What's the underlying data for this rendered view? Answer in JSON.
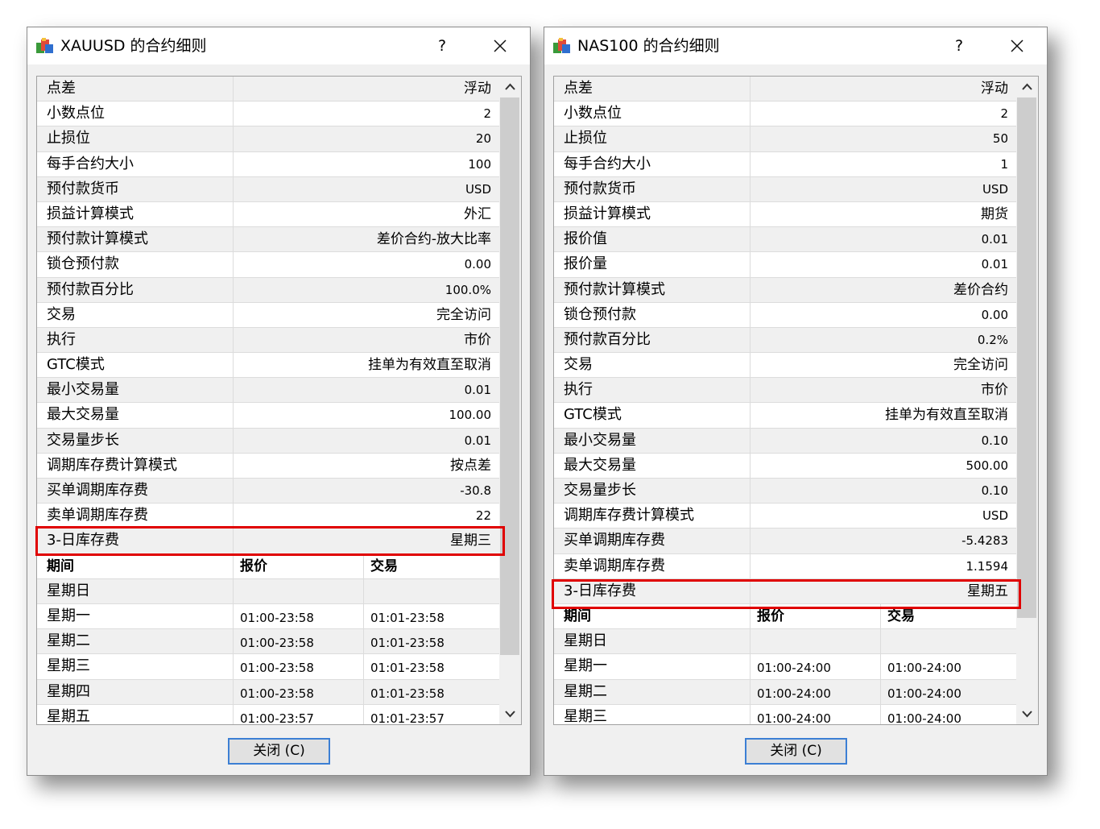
{
  "colors": {
    "highlight": "#e00000",
    "button_border": "#3c7fd4"
  },
  "dialogs": [
    {
      "title": "XAUUSD 的合约细则",
      "help": "?",
      "close_label": "关闭 (C)",
      "rows": [
        {
          "label": "点差",
          "value": "浮动"
        },
        {
          "label": "小数点位",
          "value": "2"
        },
        {
          "label": "止损位",
          "value": "20"
        },
        {
          "label": "每手合约大小",
          "value": "100"
        },
        {
          "label": "预付款货币",
          "value": "USD"
        },
        {
          "label": "损益计算模式",
          "value": "外汇"
        },
        {
          "label": "预付款计算模式",
          "value": "差价合约-放大比率"
        },
        {
          "label": "锁仓预付款",
          "value": "0.00"
        },
        {
          "label": "预付款百分比",
          "value": "100.0%"
        },
        {
          "label": "交易",
          "value": "完全访问"
        },
        {
          "label": "执行",
          "value": "市价"
        },
        {
          "label": "GTC模式",
          "value": "挂单为有效直至取消"
        },
        {
          "label": "最小交易量",
          "value": "0.01"
        },
        {
          "label": "最大交易量",
          "value": "100.00"
        },
        {
          "label": "交易量步长",
          "value": "0.01"
        },
        {
          "label": "调期库存费计算模式",
          "value": "按点差"
        },
        {
          "label": "买单调期库存费",
          "value": "-30.8"
        },
        {
          "label": "卖单调期库存费",
          "value": "22"
        },
        {
          "label": "3-日库存费",
          "value": "星期三"
        }
      ],
      "schedule_header": {
        "day": "期间",
        "quote": "报价",
        "trade": "交易"
      },
      "schedule": [
        {
          "day": "星期日",
          "quote": "",
          "trade": ""
        },
        {
          "day": "星期一",
          "quote": "01:00-23:58",
          "trade": "01:01-23:58"
        },
        {
          "day": "星期二",
          "quote": "01:00-23:58",
          "trade": "01:01-23:58"
        },
        {
          "day": "星期三",
          "quote": "01:00-23:58",
          "trade": "01:01-23:58"
        },
        {
          "day": "星期四",
          "quote": "01:00-23:58",
          "trade": "01:01-23:58"
        },
        {
          "day": "星期五",
          "quote": "01:00-23:57",
          "trade": "01:01-23:57"
        }
      ]
    },
    {
      "title": "NAS100 的合约细则",
      "help": "?",
      "close_label": "关闭 (C)",
      "rows": [
        {
          "label": "点差",
          "value": "浮动"
        },
        {
          "label": "小数点位",
          "value": "2"
        },
        {
          "label": "止损位",
          "value": "50"
        },
        {
          "label": "每手合约大小",
          "value": "1"
        },
        {
          "label": "预付款货币",
          "value": "USD"
        },
        {
          "label": "损益计算模式",
          "value": "期货"
        },
        {
          "label": "报价值",
          "value": "0.01"
        },
        {
          "label": "报价量",
          "value": "0.01"
        },
        {
          "label": "预付款计算模式",
          "value": "差价合约"
        },
        {
          "label": "锁仓预付款",
          "value": "0.00"
        },
        {
          "label": "预付款百分比",
          "value": "0.2%"
        },
        {
          "label": "交易",
          "value": "完全访问"
        },
        {
          "label": "执行",
          "value": "市价"
        },
        {
          "label": "GTC模式",
          "value": "挂单为有效直至取消"
        },
        {
          "label": "最小交易量",
          "value": "0.10"
        },
        {
          "label": "最大交易量",
          "value": "500.00"
        },
        {
          "label": "交易量步长",
          "value": "0.10"
        },
        {
          "label": "调期库存费计算模式",
          "value": "USD"
        },
        {
          "label": "买单调期库存费",
          "value": "-5.4283"
        },
        {
          "label": "卖单调期库存费",
          "value": "1.1594"
        },
        {
          "label": "3-日库存费",
          "value": "星期五"
        }
      ],
      "schedule_header": {
        "day": "期间",
        "quote": "报价",
        "trade": "交易"
      },
      "schedule": [
        {
          "day": "星期日",
          "quote": "",
          "trade": ""
        },
        {
          "day": "星期一",
          "quote": "01:00-24:00",
          "trade": "01:00-24:00"
        },
        {
          "day": "星期二",
          "quote": "01:00-24:00",
          "trade": "01:00-24:00"
        },
        {
          "day": "星期三",
          "quote": "01:00-24:00",
          "trade": "01:00-24:00"
        }
      ]
    }
  ]
}
